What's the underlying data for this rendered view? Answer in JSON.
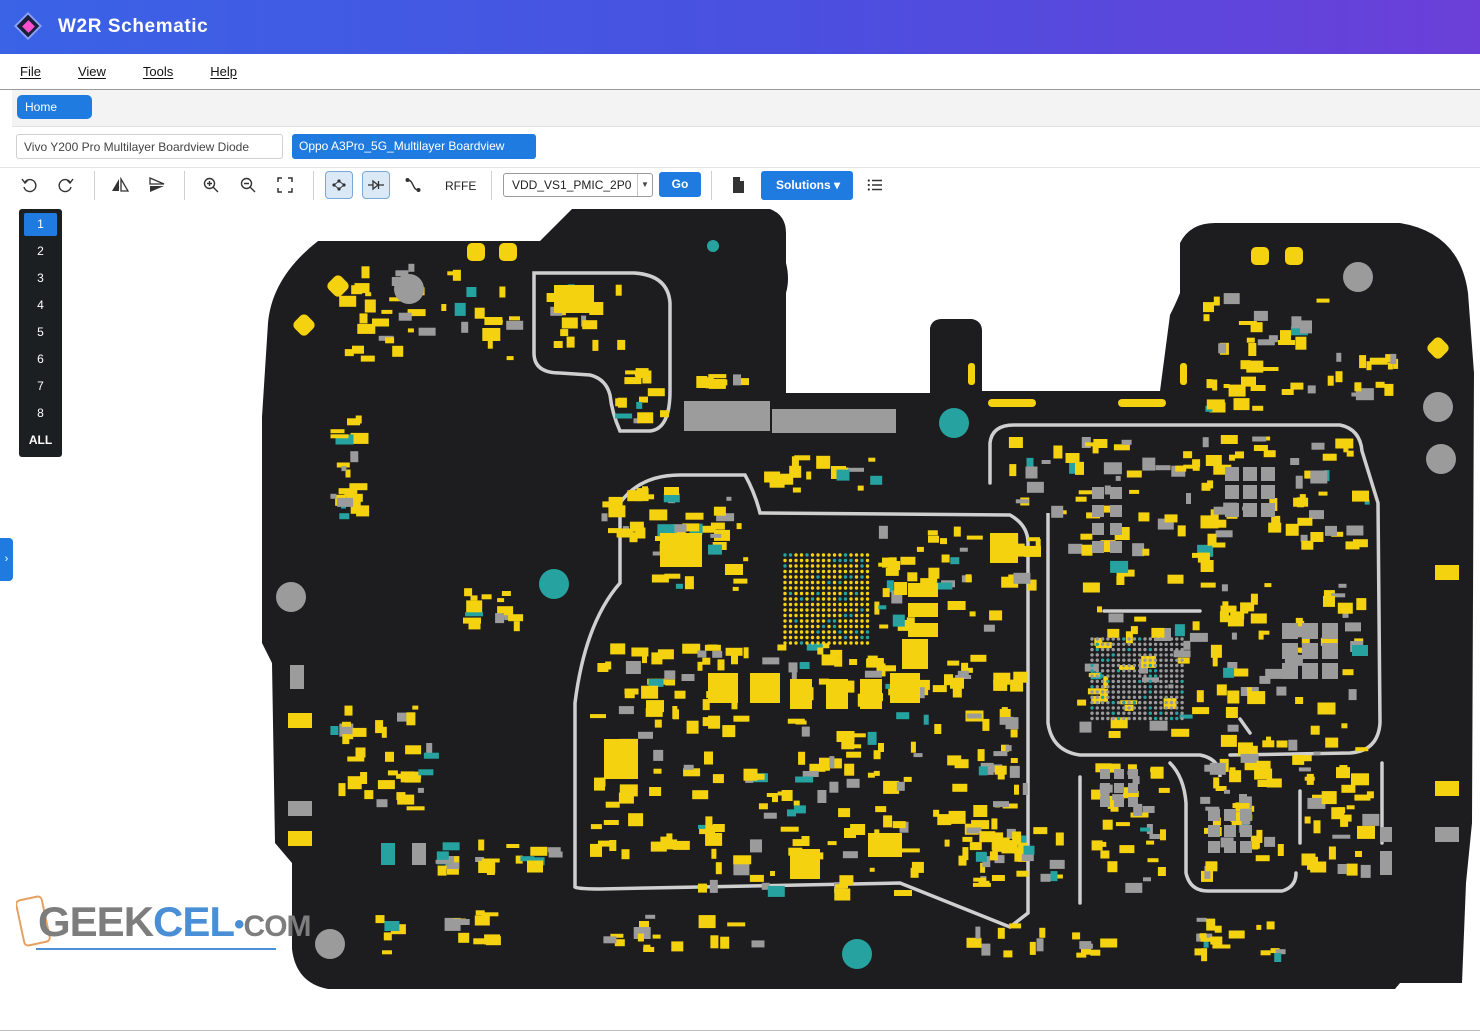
{
  "app": {
    "title": "W2R Schematic"
  },
  "menu": [
    "File",
    "View",
    "Tools",
    "Help"
  ],
  "home_tab": "Home",
  "board_tabs": [
    {
      "label": "Vivo Y200 Pro Multilayer Boardview Diode",
      "active": false
    },
    {
      "label": "Oppo A3Pro_5G_Multilayer Boardview",
      "active": true
    }
  ],
  "toolbar": {
    "rfe_label": "RFFE",
    "net_select": "VDD_VS1_PMIC_2P0",
    "go_label": "Go",
    "solutions_label": "Solutions ▾"
  },
  "layers": [
    "1",
    "2",
    "3",
    "4",
    "5",
    "6",
    "7",
    "8",
    "ALL"
  ],
  "selected_layer": "1",
  "watermark": {
    "geek": "GEEK",
    "cel": "CEL",
    "com": "COM"
  },
  "colors": {
    "accent": "#1f7be0",
    "board": "#1d1d1f",
    "pad": "#f5d20f",
    "via": "#26a3a0",
    "hole": "#9b9b9b",
    "trace": "#22406a"
  }
}
